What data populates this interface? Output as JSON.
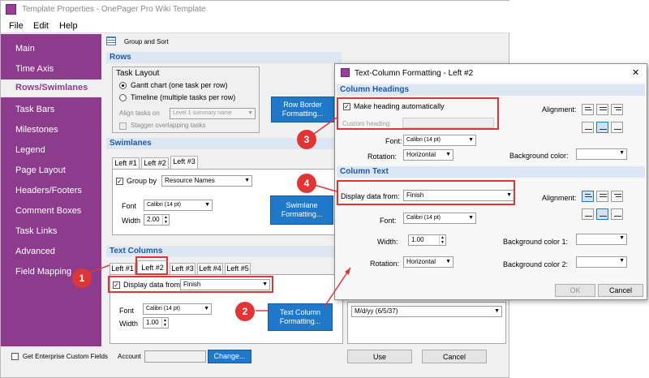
{
  "window": {
    "title": "Template Properties - OnePager Pro Wiki Template"
  },
  "menu": [
    "File",
    "Edit",
    "Help"
  ],
  "sidebar": {
    "items": [
      "Main",
      "Time Axis",
      "Rows/Swimlanes",
      "Task Bars",
      "Milestones",
      "Legend",
      "Page Layout",
      "Headers/Footers",
      "Comment Boxes",
      "Task Links",
      "Advanced",
      "Field Mapping"
    ],
    "active": "Rows/Swimlanes"
  },
  "toolbar": {
    "group_sort": "Group and Sort"
  },
  "rows": {
    "header": "Rows",
    "task_layout_title": "Task Layout",
    "gantt_option": "Gantt chart (one task per row)",
    "timeline_option": "Timeline (multiple tasks per row)",
    "align_label": "Align tasks on",
    "align_value": "Level 1 summary name",
    "stagger_label": "Stagger overlapping tasks",
    "row_border_button": "Row Border Formatting..."
  },
  "swimlanes": {
    "header": "Swimlanes",
    "tabs": [
      "Left #1",
      "Left #2",
      "Left #3"
    ],
    "group_by_label": "Group by",
    "group_by_value": "Resource Names",
    "font_label": "Font",
    "font_value": "Calibri (14 pt)",
    "width_label": "Width",
    "width_value": "2.00",
    "button": "Swimlane Formatting..."
  },
  "text_columns": {
    "header": "Text Columns",
    "tabs": [
      "Left #1",
      "Left #2",
      "Left #3",
      "Left #4",
      "Left #5"
    ],
    "display_label": "Display data from",
    "display_value": "Finish",
    "font_label": "Font",
    "font_value": "Calibri (14 pt)",
    "width_label": "Width",
    "width_value": "1.00",
    "button": "Text Column Formatting...",
    "date_format": "M/d/yy (6/5/37)"
  },
  "footer": {
    "enterprise_label": "Get Enterprise Custom Fields",
    "account_label": "Account",
    "change_button": "Change...",
    "use_button": "Use",
    "cancel_button": "Cancel"
  },
  "dialog": {
    "title": "Text-Column Formatting - Left #2",
    "close": "✕",
    "headings_header": "Column Headings",
    "make_heading_label": "Make heading automatically",
    "custom_heading_label": "Custom heading:",
    "font_label": "Font:",
    "font_value": "Calibri (14 pt)",
    "rotation_label": "Rotation:",
    "rotation_value": "Horizontal",
    "alignment_label": "Alignment:",
    "bg_label": "Background color:",
    "text_header": "Column Text",
    "display_label": "Display data from:",
    "display_value": "Finish",
    "text_font_label": "Font:",
    "text_font_value": "Calibri (14 pt)",
    "width_label": "Width:",
    "width_value": "1.00",
    "text_rotation_label": "Rotation:",
    "text_rotation_value": "Horizontal",
    "text_alignment_label": "Alignment:",
    "bg1_label": "Background color 1:",
    "bg2_label": "Background color 2:",
    "ok_button": "OK",
    "cancel_button": "Cancel"
  },
  "callouts": [
    "1",
    "2",
    "3",
    "4"
  ],
  "colors": {
    "accent": "#8d3c8d",
    "blue_button": "#1f78c8",
    "callout": "#e03535",
    "section_text": "#1f5aa6"
  }
}
